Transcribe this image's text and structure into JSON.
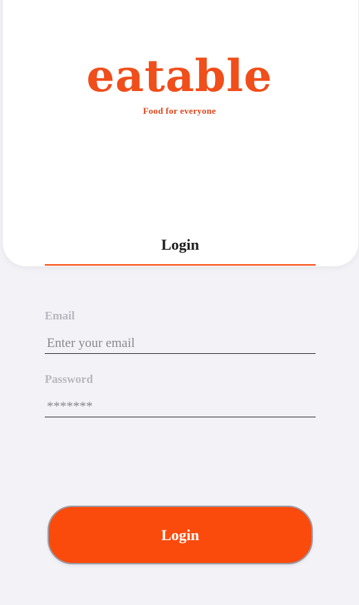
{
  "brand": {
    "logo_text": "eatable",
    "tagline": "Food for everyone",
    "color": "#fa4a0c"
  },
  "tabs": {
    "login_label": "Login"
  },
  "form": {
    "email_label": "Email",
    "email_placeholder": "Enter your email",
    "password_label": "Password",
    "password_placeholder": "*******"
  },
  "actions": {
    "login_button_label": "Login"
  },
  "colors": {
    "background": "#f2f2f7",
    "card": "#ffffff",
    "accent": "#fa4a0c",
    "label_gray": "#b7b7bd"
  }
}
